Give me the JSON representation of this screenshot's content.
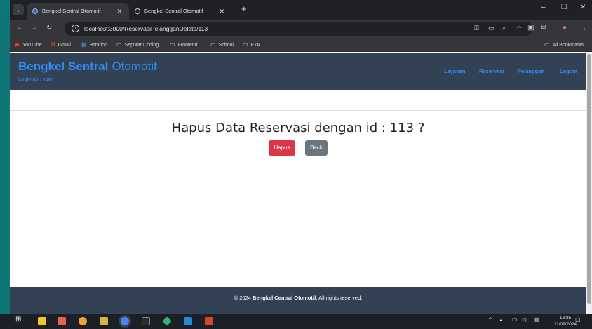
{
  "browser": {
    "tabs": [
      {
        "title": "Bengkel Sentral Otomotif",
        "active": true
      },
      {
        "title": "Bengkel Sentral Otomotif",
        "active": false
      }
    ],
    "url": "localhost:3000/ReservasiPelangganDelete/113",
    "bookmarks": [
      "YouTube",
      "Gmail",
      "Bstation",
      "Seputar Coding",
      "Frontend",
      "School",
      "FYA"
    ],
    "all_bookmarks": "All Bookmarks"
  },
  "navbar": {
    "brand_bold": "Bengkel Sentral",
    "brand_light": "Otomotif",
    "login_text": "Login as : kum",
    "links": [
      "Layanan",
      "Reservasi",
      "Pelanggan",
      "Logout"
    ]
  },
  "main": {
    "heading": "Hapus Data Reservasi dengan id : 113 ?",
    "delete_label": "Hapus",
    "back_label": "Back"
  },
  "footer": {
    "prefix": "© 2024",
    "brand": "Bengkel Central Otomotif",
    "suffix": ". All rights reserved."
  },
  "taskbar": {
    "time": "13:25",
    "date": "11/07/2024"
  },
  "colors": {
    "navbar": "#334155",
    "brand": "#2f8cf5",
    "danger": "#dc3545",
    "secondary": "#6c757d"
  }
}
